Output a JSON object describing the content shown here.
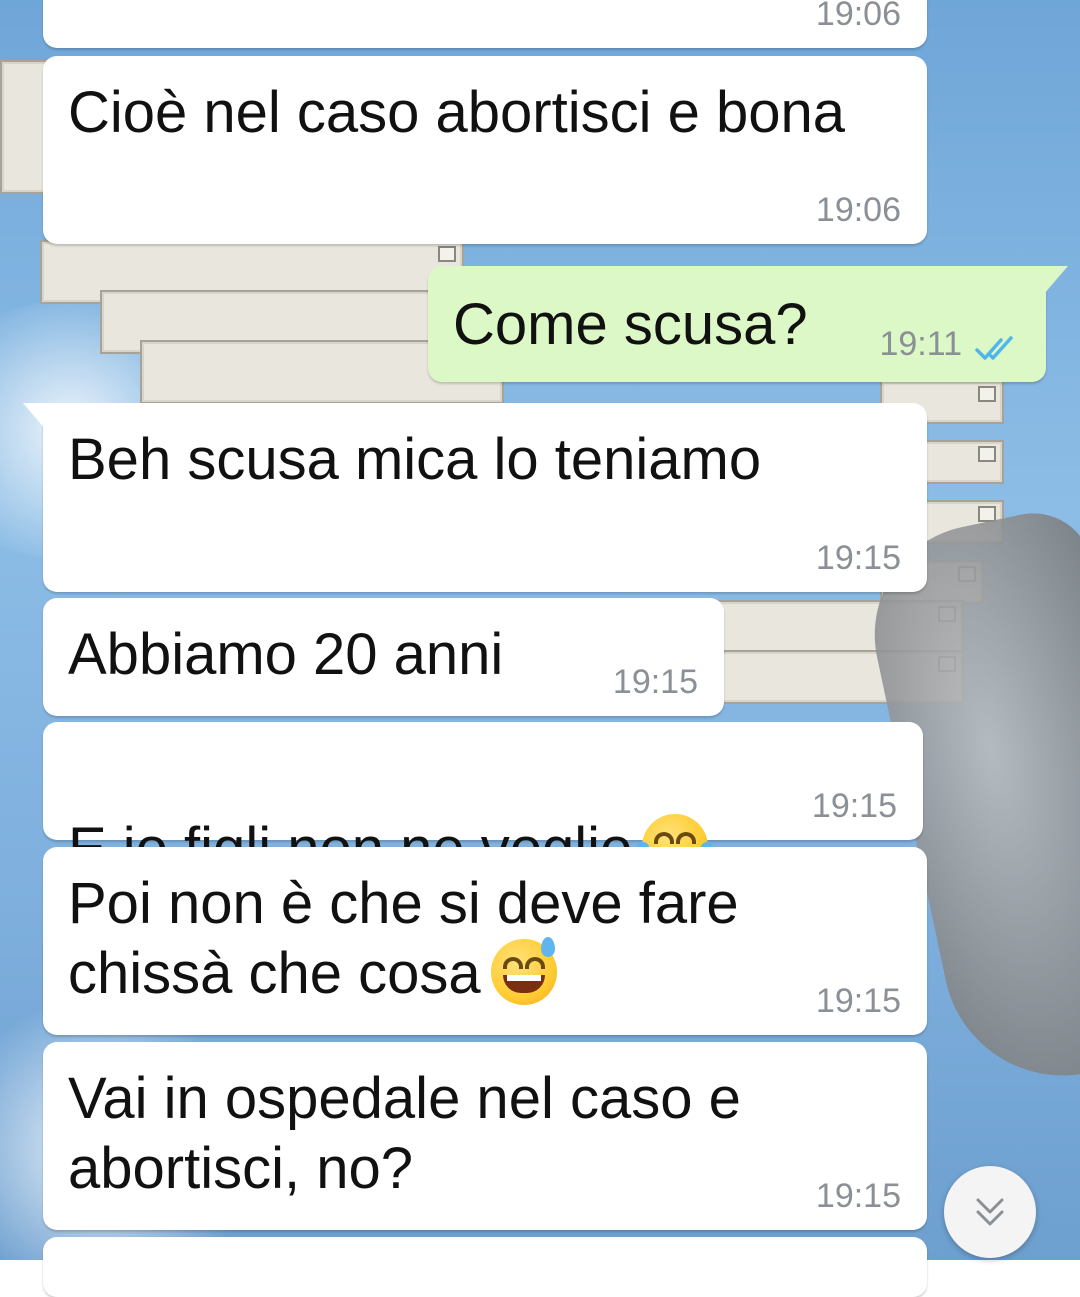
{
  "messages": [
    {
      "dir": "in",
      "text": "",
      "time": "19:06"
    },
    {
      "dir": "in",
      "text": "Cioè nel caso abortisci e bona",
      "time": "19:06"
    },
    {
      "dir": "out",
      "text": "Come scusa?",
      "time": "19:11",
      "status": "read"
    },
    {
      "dir": "in",
      "text": "Beh scusa mica lo teniamo",
      "time": "19:15"
    },
    {
      "dir": "in",
      "text": "Abbiamo 20 anni",
      "time": "19:15"
    },
    {
      "dir": "in",
      "text": "E io figli non ne voglio",
      "time": "19:15",
      "emoji": "face-with-tears-of-joy"
    },
    {
      "dir": "in",
      "text": "Poi non è che si deve fare\nchissà che cosa",
      "time": "19:15",
      "emoji": "grinning-face-with-sweat"
    },
    {
      "dir": "in",
      "text": "Vai in ospedale nel caso e\nabortisci, no?",
      "time": "19:15"
    }
  ],
  "colors": {
    "incoming_bubble": "#ffffff",
    "outgoing_bubble": "#dcf8c6",
    "read_ticks": "#4fb6ec",
    "timestamp": "#8a9096"
  },
  "controls": {
    "scroll_down_icon": "double-chevron-down-icon"
  }
}
